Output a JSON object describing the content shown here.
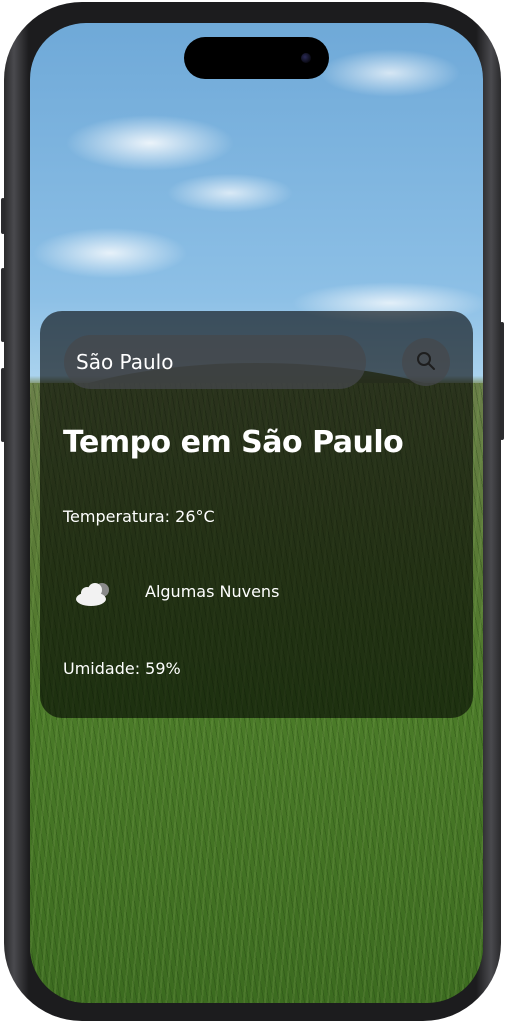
{
  "search": {
    "value": "São Paulo",
    "button_icon": "search-icon"
  },
  "weather": {
    "title": "Tempo em São Paulo",
    "temperature": "Temperatura: 26°C",
    "icon": "cloud-icon",
    "description": "Algumas Nuvens",
    "humidity": "Umidade: 59%"
  },
  "colors": {
    "card_background": "#000000",
    "text": "#ffffff",
    "input_background": "#46484c"
  }
}
